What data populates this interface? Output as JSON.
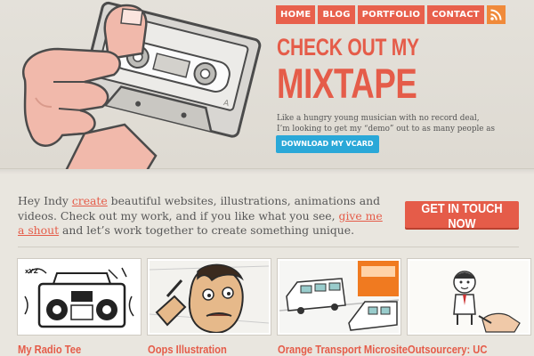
{
  "nav": {
    "items": [
      {
        "label": "HOME"
      },
      {
        "label": "BLOG"
      },
      {
        "label": "PORTFOLIO"
      },
      {
        "label": "CONTACT"
      }
    ],
    "rss_icon": "rss-icon"
  },
  "hero": {
    "headline_line1": "CHECK OUT MY",
    "headline_line2": "MIXTAPE",
    "tagline_line1": "Like a hungry young musician with no record deal,",
    "tagline_line2": "I’m looking to get my “demo” out to as many people as possible.",
    "vcard_button": "DOWNLOAD MY VCARD",
    "illustration": "hand-holding-cassette-tape"
  },
  "intro": {
    "t1": "Hey Indy ",
    "link1": "create",
    "t2": " beautiful websites, illustrations, animations and videos. Check out my work, and if you like what you see, ",
    "link2": "give me a shout",
    "t3": " and let’s work together to create something unique."
  },
  "cta": {
    "label": "GET IN TOUCH NOW"
  },
  "portfolio": [
    {
      "title": "My Radio Tee",
      "thumb": "boombox-doodle"
    },
    {
      "title": "Oops Illustration",
      "thumb": "cartoon-face"
    },
    {
      "title": "Orange Transport Microsite",
      "thumb": "bus-illustration"
    },
    {
      "title": "Outsourcery: UC",
      "thumb": "hand-drawing-cartoon-man"
    }
  ],
  "colors": {
    "accent": "#e55c49",
    "nav": "#e8604c",
    "rss": "#f08a3a",
    "vcard": "#2aa8d8",
    "background": "#e9e6df"
  }
}
